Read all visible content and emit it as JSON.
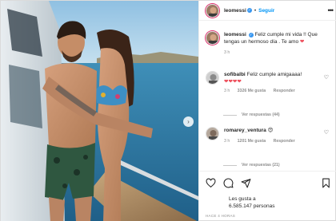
{
  "post": {
    "username": "leomessi",
    "follow_label": "Seguir",
    "separator": "•",
    "caption": {
      "username": "leomessi",
      "text": "Feliz cumple mi vida !! Que tengas un hermoso día . Te amo",
      "emoji": "❤",
      "time": "3 h"
    },
    "comments": [
      {
        "username": "sofibalbi",
        "text": "Feliz cumple amigaaaa!",
        "emoji": "❤❤❤❤",
        "time": "3 h",
        "likes": "3326 Me gusta",
        "reply_label": "Responder",
        "view_replies": "Ver respuestas (44)"
      },
      {
        "username": "romarey_ventura",
        "emoji": "😍",
        "time": "3 h",
        "likes": "1201 Me gusta",
        "reply_label": "Responder",
        "view_replies": "Ver respuestas (21)"
      }
    ],
    "likes_label": "Les gusta a",
    "likes_count": "6.585.147 personas",
    "posted_ago": "HACE 4 HORAS"
  },
  "icons": {
    "like": "heart-icon",
    "comment": "comment-icon",
    "share": "share-icon",
    "save": "bookmark-icon",
    "more": "more-options-icon",
    "verified": "verified-badge-icon",
    "next": "chevron-right-icon"
  },
  "colors": {
    "follow_blue": "#0095f6",
    "verified_blue": "#3897f0",
    "heart_red": "#ed4956",
    "sea": "#2f7fa8",
    "sky": "#a9cde6"
  }
}
